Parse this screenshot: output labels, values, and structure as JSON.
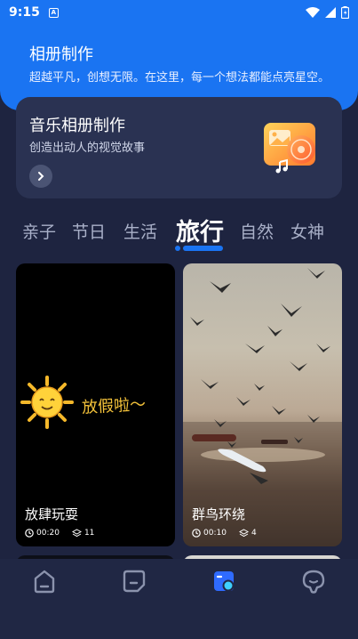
{
  "status": {
    "time": "9:15",
    "notification_glyph": "A"
  },
  "hero": {
    "title": "相册制作",
    "subtitle": "超越平凡，创想无限。在这里，每一个想法都能点亮星空。"
  },
  "feature_card": {
    "title": "音乐相册制作",
    "subtitle": "创造出动人的视觉故事",
    "icon": "music-album-illustration"
  },
  "tabs": [
    {
      "label": "亲子",
      "active": false
    },
    {
      "label": "节日",
      "active": false
    },
    {
      "label": "生活",
      "active": false
    },
    {
      "label": "旅行",
      "active": true
    },
    {
      "label": "自然",
      "active": false
    },
    {
      "label": "女神",
      "active": false
    }
  ],
  "templates": [
    {
      "name": "放肆玩耍",
      "duration": "00:20",
      "photos": "11",
      "overlay_text": "放假啦～"
    },
    {
      "name": "群鸟环绕",
      "duration": "00:10",
      "photos": "4"
    }
  ],
  "bottom_nav": [
    {
      "icon": "home-icon",
      "active": false
    },
    {
      "icon": "note-icon",
      "active": false
    },
    {
      "icon": "album-icon",
      "active": true
    },
    {
      "icon": "profile-icon",
      "active": false
    }
  ],
  "colors": {
    "accent": "#1a74f2",
    "background": "#1e2440",
    "card": "#2a3252"
  }
}
